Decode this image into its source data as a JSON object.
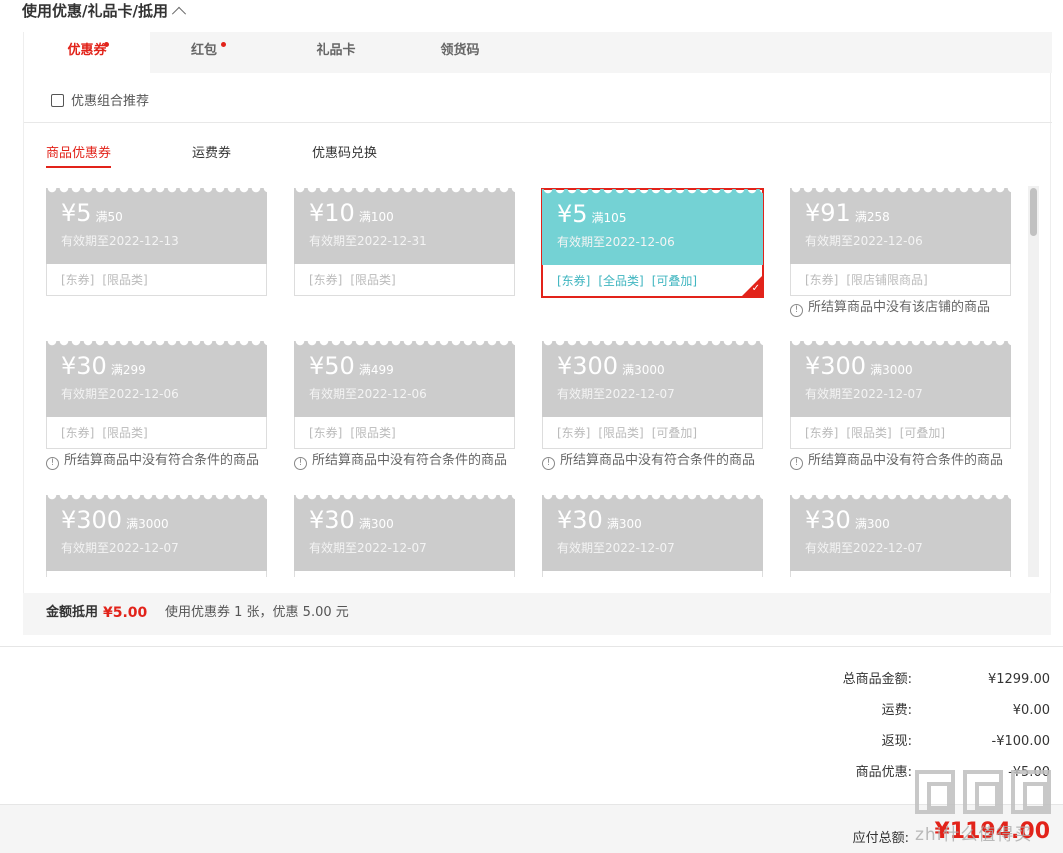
{
  "section": {
    "title": "使用优惠/礼品卡/抵用"
  },
  "tabs": [
    {
      "label": "优惠券",
      "dot": true,
      "active": true
    },
    {
      "label": "红包",
      "dot": true,
      "active": false
    },
    {
      "label": "礼品卡",
      "dot": false,
      "active": false
    },
    {
      "label": "领货码",
      "dot": false,
      "active": false
    }
  ],
  "recommend": {
    "label": "优惠组合推荐",
    "checked": false
  },
  "subtabs": [
    {
      "label": "商品优惠券",
      "active": true
    },
    {
      "label": "运费券",
      "active": false
    },
    {
      "label": "优惠码兑换",
      "active": false
    }
  ],
  "coupons": [
    {
      "amount": "¥5",
      "condition": "满50",
      "expiry": "有效期至2022-12-13",
      "tags": [
        "[东券]",
        "[限品类]"
      ],
      "note": "",
      "selected": false
    },
    {
      "amount": "¥10",
      "condition": "满100",
      "expiry": "有效期至2022-12-31",
      "tags": [
        "[东券]",
        "[限品类]"
      ],
      "note": "",
      "selected": false
    },
    {
      "amount": "¥5",
      "condition": "满105",
      "expiry": "有效期至2022-12-06",
      "tags": [
        "[东券]",
        "[全品类]",
        "[可叠加]"
      ],
      "note": "",
      "selected": true
    },
    {
      "amount": "¥91",
      "condition": "满258",
      "expiry": "有效期至2022-12-06",
      "tags": [
        "[东券]",
        "[限店铺限商品]"
      ],
      "note": "所结算商品中没有该店铺的商品",
      "selected": false
    },
    {
      "amount": "¥30",
      "condition": "满299",
      "expiry": "有效期至2022-12-06",
      "tags": [
        "[东券]",
        "[限品类]"
      ],
      "note": "所结算商品中没有符合条件的商品",
      "selected": false
    },
    {
      "amount": "¥50",
      "condition": "满499",
      "expiry": "有效期至2022-12-06",
      "tags": [
        "[东券]",
        "[限品类]"
      ],
      "note": "所结算商品中没有符合条件的商品",
      "selected": false
    },
    {
      "amount": "¥300",
      "condition": "满3000",
      "expiry": "有效期至2022-12-07",
      "tags": [
        "[东券]",
        "[限品类]",
        "[可叠加]"
      ],
      "note": "所结算商品中没有符合条件的商品",
      "selected": false
    },
    {
      "amount": "¥300",
      "condition": "满3000",
      "expiry": "有效期至2022-12-07",
      "tags": [
        "[东券]",
        "[限品类]",
        "[可叠加]"
      ],
      "note": "所结算商品中没有符合条件的商品",
      "selected": false
    },
    {
      "amount": "¥300",
      "condition": "满3000",
      "expiry": "有效期至2022-12-07",
      "tags": [],
      "note": "",
      "selected": false
    },
    {
      "amount": "¥30",
      "condition": "满300",
      "expiry": "有效期至2022-12-07",
      "tags": [],
      "note": "",
      "selected": false
    },
    {
      "amount": "¥30",
      "condition": "满300",
      "expiry": "有效期至2022-12-07",
      "tags": [],
      "note": "",
      "selected": false
    },
    {
      "amount": "¥30",
      "condition": "满300",
      "expiry": "有效期至2022-12-07",
      "tags": [],
      "note": "",
      "selected": false
    }
  ],
  "summary": {
    "label": "金额抵用",
    "amount": "¥5.00",
    "desc": "使用优惠券 1 张，优惠 5.00 元"
  },
  "totals": [
    {
      "label": "总商品金额:",
      "value": "¥1299.00"
    },
    {
      "label": "运费:",
      "value": "¥0.00"
    },
    {
      "label": "返现:",
      "value": "-¥100.00"
    },
    {
      "label": "商品优惠:",
      "value": "-¥5.00"
    }
  ],
  "payable": {
    "label": "应付总额:",
    "value": "¥1194.00"
  },
  "watermark": {
    "text": "zhi什么值得买"
  },
  "colors": {
    "accent": "#e2231a",
    "selected_coupon": "#74d2d4",
    "disabled_coupon": "#cccccc"
  }
}
